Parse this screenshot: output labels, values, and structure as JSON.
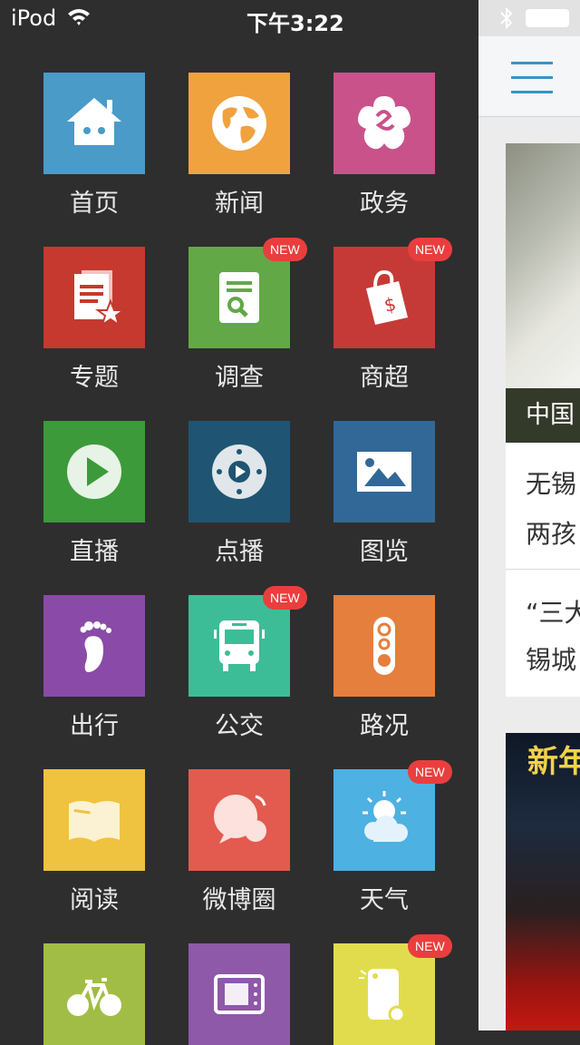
{
  "status_bar": {
    "carrier": "iPod",
    "time": "下午3:22"
  },
  "menu": {
    "items": [
      {
        "label": "首页",
        "color": "#4a9bc8",
        "icon": "home-icon",
        "badge": ""
      },
      {
        "label": "新闻",
        "color": "#f0a23e",
        "icon": "globe-icon",
        "badge": ""
      },
      {
        "label": "政务",
        "color": "#c9528a",
        "icon": "flower-icon",
        "badge": ""
      },
      {
        "label": "专题",
        "color": "#c6392f",
        "icon": "document-star-icon",
        "badge": ""
      },
      {
        "label": "调查",
        "color": "#62a847",
        "icon": "document-search-icon",
        "badge": "NEW"
      },
      {
        "label": "商超",
        "color": "#c53a36",
        "icon": "shopping-bag-icon",
        "badge": "NEW"
      },
      {
        "label": "直播",
        "color": "#3c9a3a",
        "icon": "play-icon",
        "badge": ""
      },
      {
        "label": "点播",
        "color": "#1f5572",
        "icon": "video-dial-icon",
        "badge": ""
      },
      {
        "label": "图览",
        "color": "#326897",
        "icon": "picture-icon",
        "badge": ""
      },
      {
        "label": "出行",
        "color": "#8a4ba8",
        "icon": "footprint-icon",
        "badge": ""
      },
      {
        "label": "公交",
        "color": "#3cbd97",
        "icon": "bus-icon",
        "badge": "NEW"
      },
      {
        "label": "路况",
        "color": "#e47f3e",
        "icon": "traffic-light-icon",
        "badge": ""
      },
      {
        "label": "阅读",
        "color": "#efc23f",
        "icon": "book-icon",
        "badge": ""
      },
      {
        "label": "微博圈",
        "color": "#e35a4f",
        "icon": "chat-bubble-icon",
        "badge": ""
      },
      {
        "label": "天气",
        "color": "#4db1e2",
        "icon": "weather-icon",
        "badge": "NEW"
      },
      {
        "label": "",
        "color": "#a2bd45",
        "icon": "bicycle-icon",
        "badge": ""
      },
      {
        "label": "",
        "color": "#8e59a9",
        "icon": "ticket-icon",
        "badge": ""
      },
      {
        "label": "",
        "color": "#e1dc4d",
        "icon": "phone-icon",
        "badge": "NEW"
      }
    ]
  },
  "content": {
    "photo_caption": "中国",
    "news": [
      {
        "line1": "无锡",
        "line2": "两孩"
      },
      {
        "line1": "“三大",
        "line2": "锡城"
      }
    ],
    "banner_text": "新年"
  }
}
